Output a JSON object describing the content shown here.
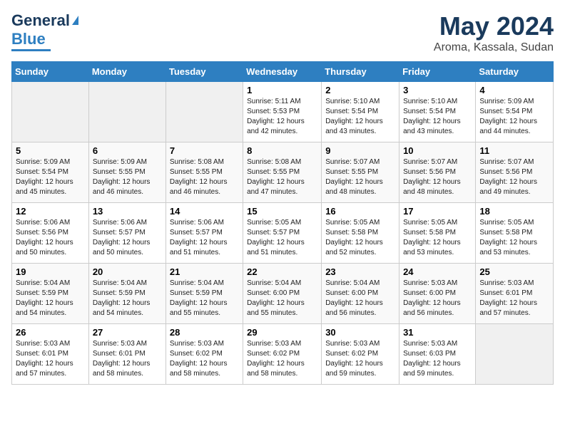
{
  "header": {
    "logo_line1": "General",
    "logo_line2": "Blue",
    "month": "May 2024",
    "location": "Aroma, Kassala, Sudan"
  },
  "days_of_week": [
    "Sunday",
    "Monday",
    "Tuesday",
    "Wednesday",
    "Thursday",
    "Friday",
    "Saturday"
  ],
  "weeks": [
    [
      {
        "day": "",
        "info": ""
      },
      {
        "day": "",
        "info": ""
      },
      {
        "day": "",
        "info": ""
      },
      {
        "day": "1",
        "info": "Sunrise: 5:11 AM\nSunset: 5:53 PM\nDaylight: 12 hours and 42 minutes."
      },
      {
        "day": "2",
        "info": "Sunrise: 5:10 AM\nSunset: 5:54 PM\nDaylight: 12 hours and 43 minutes."
      },
      {
        "day": "3",
        "info": "Sunrise: 5:10 AM\nSunset: 5:54 PM\nDaylight: 12 hours and 43 minutes."
      },
      {
        "day": "4",
        "info": "Sunrise: 5:09 AM\nSunset: 5:54 PM\nDaylight: 12 hours and 44 minutes."
      }
    ],
    [
      {
        "day": "5",
        "info": "Sunrise: 5:09 AM\nSunset: 5:54 PM\nDaylight: 12 hours and 45 minutes."
      },
      {
        "day": "6",
        "info": "Sunrise: 5:09 AM\nSunset: 5:55 PM\nDaylight: 12 hours and 46 minutes."
      },
      {
        "day": "7",
        "info": "Sunrise: 5:08 AM\nSunset: 5:55 PM\nDaylight: 12 hours and 46 minutes."
      },
      {
        "day": "8",
        "info": "Sunrise: 5:08 AM\nSunset: 5:55 PM\nDaylight: 12 hours and 47 minutes."
      },
      {
        "day": "9",
        "info": "Sunrise: 5:07 AM\nSunset: 5:55 PM\nDaylight: 12 hours and 48 minutes."
      },
      {
        "day": "10",
        "info": "Sunrise: 5:07 AM\nSunset: 5:56 PM\nDaylight: 12 hours and 48 minutes."
      },
      {
        "day": "11",
        "info": "Sunrise: 5:07 AM\nSunset: 5:56 PM\nDaylight: 12 hours and 49 minutes."
      }
    ],
    [
      {
        "day": "12",
        "info": "Sunrise: 5:06 AM\nSunset: 5:56 PM\nDaylight: 12 hours and 50 minutes."
      },
      {
        "day": "13",
        "info": "Sunrise: 5:06 AM\nSunset: 5:57 PM\nDaylight: 12 hours and 50 minutes."
      },
      {
        "day": "14",
        "info": "Sunrise: 5:06 AM\nSunset: 5:57 PM\nDaylight: 12 hours and 51 minutes."
      },
      {
        "day": "15",
        "info": "Sunrise: 5:05 AM\nSunset: 5:57 PM\nDaylight: 12 hours and 51 minutes."
      },
      {
        "day": "16",
        "info": "Sunrise: 5:05 AM\nSunset: 5:58 PM\nDaylight: 12 hours and 52 minutes."
      },
      {
        "day": "17",
        "info": "Sunrise: 5:05 AM\nSunset: 5:58 PM\nDaylight: 12 hours and 53 minutes."
      },
      {
        "day": "18",
        "info": "Sunrise: 5:05 AM\nSunset: 5:58 PM\nDaylight: 12 hours and 53 minutes."
      }
    ],
    [
      {
        "day": "19",
        "info": "Sunrise: 5:04 AM\nSunset: 5:59 PM\nDaylight: 12 hours and 54 minutes."
      },
      {
        "day": "20",
        "info": "Sunrise: 5:04 AM\nSunset: 5:59 PM\nDaylight: 12 hours and 54 minutes."
      },
      {
        "day": "21",
        "info": "Sunrise: 5:04 AM\nSunset: 5:59 PM\nDaylight: 12 hours and 55 minutes."
      },
      {
        "day": "22",
        "info": "Sunrise: 5:04 AM\nSunset: 6:00 PM\nDaylight: 12 hours and 55 minutes."
      },
      {
        "day": "23",
        "info": "Sunrise: 5:04 AM\nSunset: 6:00 PM\nDaylight: 12 hours and 56 minutes."
      },
      {
        "day": "24",
        "info": "Sunrise: 5:03 AM\nSunset: 6:00 PM\nDaylight: 12 hours and 56 minutes."
      },
      {
        "day": "25",
        "info": "Sunrise: 5:03 AM\nSunset: 6:01 PM\nDaylight: 12 hours and 57 minutes."
      }
    ],
    [
      {
        "day": "26",
        "info": "Sunrise: 5:03 AM\nSunset: 6:01 PM\nDaylight: 12 hours and 57 minutes."
      },
      {
        "day": "27",
        "info": "Sunrise: 5:03 AM\nSunset: 6:01 PM\nDaylight: 12 hours and 58 minutes."
      },
      {
        "day": "28",
        "info": "Sunrise: 5:03 AM\nSunset: 6:02 PM\nDaylight: 12 hours and 58 minutes."
      },
      {
        "day": "29",
        "info": "Sunrise: 5:03 AM\nSunset: 6:02 PM\nDaylight: 12 hours and 58 minutes."
      },
      {
        "day": "30",
        "info": "Sunrise: 5:03 AM\nSunset: 6:02 PM\nDaylight: 12 hours and 59 minutes."
      },
      {
        "day": "31",
        "info": "Sunrise: 5:03 AM\nSunset: 6:03 PM\nDaylight: 12 hours and 59 minutes."
      },
      {
        "day": "",
        "info": ""
      }
    ]
  ]
}
